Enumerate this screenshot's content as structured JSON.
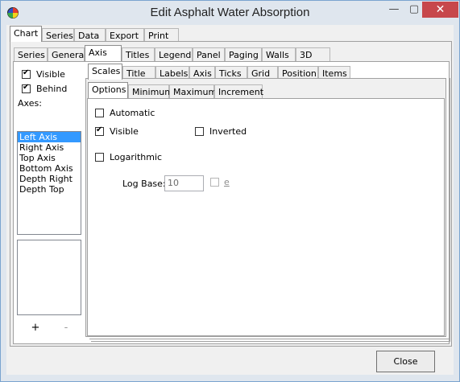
{
  "window": {
    "title": "Edit Asphalt Water Absorption"
  },
  "main_tabs": [
    "Chart",
    "Series",
    "Data",
    "Export",
    "Print"
  ],
  "chart_tabs": [
    "Series",
    "General",
    "Axis",
    "Titles",
    "Legend",
    "Panel",
    "Paging",
    "Walls",
    "3D"
  ],
  "axis_tabs": [
    "Scales",
    "Title",
    "Labels",
    "Axis",
    "Ticks",
    "Grid",
    "Position",
    "Items"
  ],
  "scales_tabs": [
    "Options",
    "Minimum",
    "Maximum",
    "Increment"
  ],
  "left": {
    "visible_label": "Visible",
    "behind_label": "Behind",
    "axes_label": "Axes:",
    "axes": [
      "Left Axis",
      "Right Axis",
      "Top Axis",
      "Bottom Axis",
      "Depth Right",
      "Depth Top"
    ],
    "selected_axis": "Left Axis",
    "add_label": "+",
    "remove_label": "-"
  },
  "options": {
    "automatic_label": "Automatic",
    "visible_label": "Visible",
    "inverted_label": "Inverted",
    "logarithmic_label": "Logarithmic",
    "log_base_label": "Log Base:",
    "log_base_value": "10",
    "e_label": "e"
  },
  "footer": {
    "close_label": "Close"
  }
}
